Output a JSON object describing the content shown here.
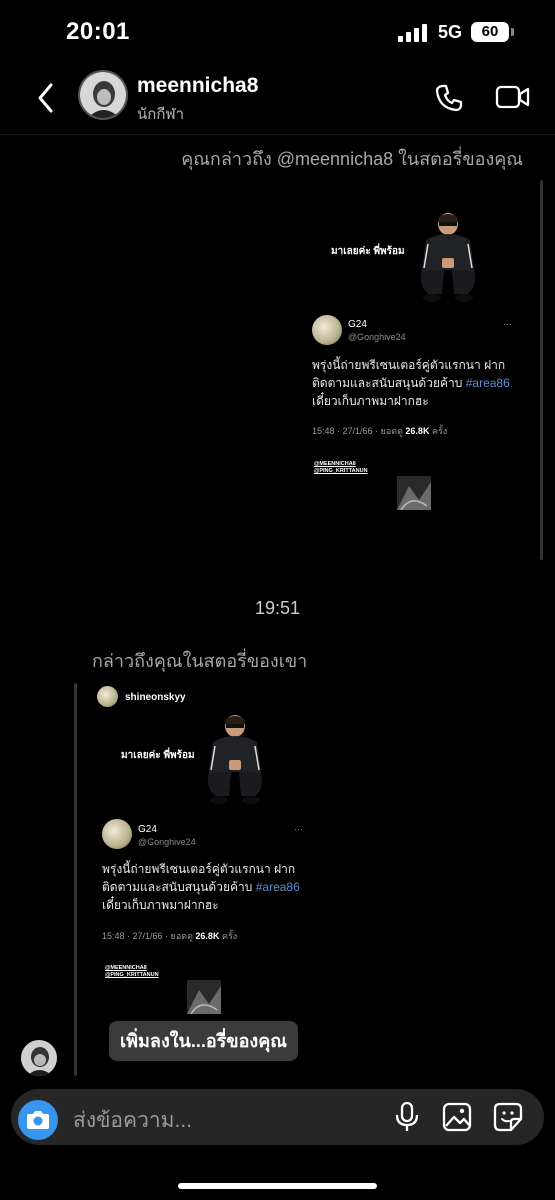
{
  "status_bar": {
    "time": "20:01",
    "network": "5G",
    "battery": "60"
  },
  "header": {
    "username": "meennicha8",
    "subtitle": "นักกีฬา"
  },
  "thread": {
    "mention_sent": "คุณกล่าวถึง @meennicha8 ในสตอรี่ของคุณ",
    "timestamp": "19:51",
    "mention_received": "กล่าวถึงคุณในสตอรี่ของเขา",
    "story_owner": "shineonskyy",
    "add_to_story_label": "เพิ่มลงใน...อรี่ของคุณ"
  },
  "story_post": {
    "caption": "มาเลยค่ะ พี่พร้อม",
    "tweet_name": "G24",
    "tweet_handle": "@Gonghive24",
    "tweet_text_1": "พรุ่งนี้ถ่ายพรีเซนเตอร์คู่ตัวแรกนา ฝาก",
    "tweet_text_2": "ติดตามและสนับสนุนด้วยค้าบ ",
    "tweet_hashtag": "#area86",
    "tweet_text_3": "เดี๋ยวเก็บภาพมาฝากฮะ",
    "tweet_meta": "15:48 · 27/1/66 · ยอดดู ",
    "tweet_views": "26.8K",
    "tweet_views_suffix": " ครั้ง",
    "tweet_more": "···",
    "credit_1": "@MEENNICHA8",
    "credit_2": "@PING_KRITTANUN"
  },
  "composer": {
    "placeholder": "ส่งข้อความ..."
  },
  "icons": {
    "back": "chevron-left-icon",
    "call": "phone-icon",
    "video": "video-camera-icon",
    "camera": "camera-icon",
    "mic": "microphone-icon",
    "gallery": "image-icon",
    "sticker": "sticker-icon"
  },
  "colors": {
    "background": "#000000",
    "accent": "#3797f0",
    "hashtag": "#5b8fd6",
    "composer": "#262626"
  }
}
